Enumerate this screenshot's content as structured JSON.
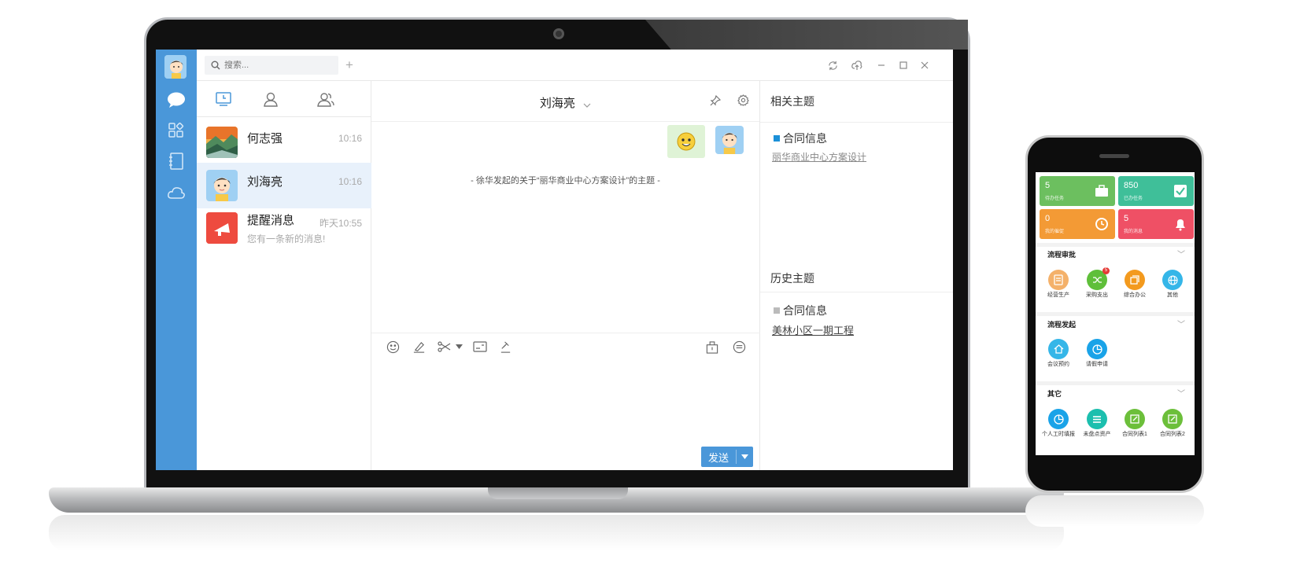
{
  "app": {
    "search_placeholder": "搜索...",
    "add_symbol": "+"
  },
  "conversations": [
    {
      "name": "何志强",
      "time": "10:16",
      "preview": ""
    },
    {
      "name": "刘海亮",
      "time": "10:16",
      "preview": ""
    },
    {
      "name": "提醒消息",
      "time": "昨天10:55",
      "preview": "您有一条新的消息!"
    }
  ],
  "chat": {
    "title": "刘海亮",
    "system_message": "- 徐华发起的关于“丽华商业中心方案设计”的主题 -",
    "send_label": "发送"
  },
  "side": {
    "related_heading": "相关主题",
    "related_topic": "合同信息",
    "related_link": "丽华商业中心方案设计",
    "history_heading": "历史主题",
    "history_topic": "合同信息",
    "history_link": "美林小区一期工程"
  },
  "phone": {
    "cards": [
      {
        "value": "5",
        "label": "待办任务",
        "color": "#6cbf5f",
        "icon": "briefcase-icon"
      },
      {
        "value": "850",
        "label": "已办任务",
        "color": "#3fbf99",
        "icon": "check-icon"
      },
      {
        "value": "0",
        "label": "我的催促",
        "color": "#f39a35",
        "icon": "clock-icon"
      },
      {
        "value": "5",
        "label": "我的消息",
        "color": "#ef5065",
        "icon": "bell-icon"
      }
    ],
    "section1": {
      "title": "流程审批",
      "items": [
        {
          "label": "经营生产",
          "color": "#f4b16a",
          "icon": "document-icon"
        },
        {
          "label": "采购支出",
          "color": "#5fbf3a",
          "icon": "shuffle-icon",
          "badge": "5"
        },
        {
          "label": "综合办公",
          "color": "#f39a1e",
          "icon": "copy-icon"
        },
        {
          "label": "其他",
          "color": "#35b6e8",
          "icon": "globe-icon"
        }
      ]
    },
    "section2": {
      "title": "流程发起",
      "items": [
        {
          "label": "会议预约",
          "color": "#35b6e8",
          "icon": "home-icon"
        },
        {
          "label": "请假申请",
          "color": "#1aa3e8",
          "icon": "pie-icon"
        }
      ]
    },
    "section3": {
      "title": "其它",
      "items": [
        {
          "label": "个人工时填报",
          "color": "#1aa3e8",
          "icon": "pie-icon"
        },
        {
          "label": "未盘点资产",
          "color": "#1cbfae",
          "icon": "list-icon"
        },
        {
          "label": "合同列表1",
          "color": "#6cbf3a",
          "icon": "edit-icon"
        },
        {
          "label": "合同列表2",
          "color": "#6cbf3a",
          "icon": "edit-icon"
        }
      ]
    }
  }
}
